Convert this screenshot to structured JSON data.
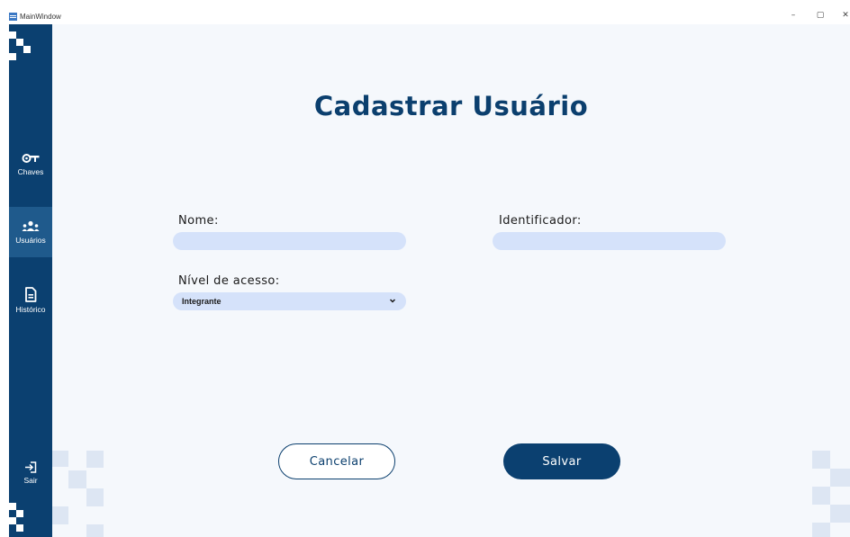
{
  "window": {
    "title": "MainWindow",
    "controls": {
      "minimize": "–",
      "restore": "▢",
      "close": "✕"
    }
  },
  "sidebar": {
    "items": [
      {
        "label": "Chaves",
        "icon": "key-icon"
      },
      {
        "label": "Usuários",
        "icon": "users-icon",
        "active": true
      },
      {
        "label": "Histórico",
        "icon": "document-icon"
      }
    ],
    "logout": {
      "label": "Sair",
      "icon": "logout-icon"
    }
  },
  "form": {
    "title": "Cadastrar Usuário",
    "name_label": "Nome:",
    "name_value": "",
    "identifier_label": "Identificador:",
    "identifier_value": "",
    "access_label": "Nível de acesso:",
    "access_selected": "Integrante",
    "cancel_label": "Cancelar",
    "save_label": "Salvar"
  },
  "colors": {
    "primary": "#0b4070",
    "active_nav": "#1f5a8c",
    "input_bg": "#d5e2fa",
    "background": "#f5f8fc"
  }
}
